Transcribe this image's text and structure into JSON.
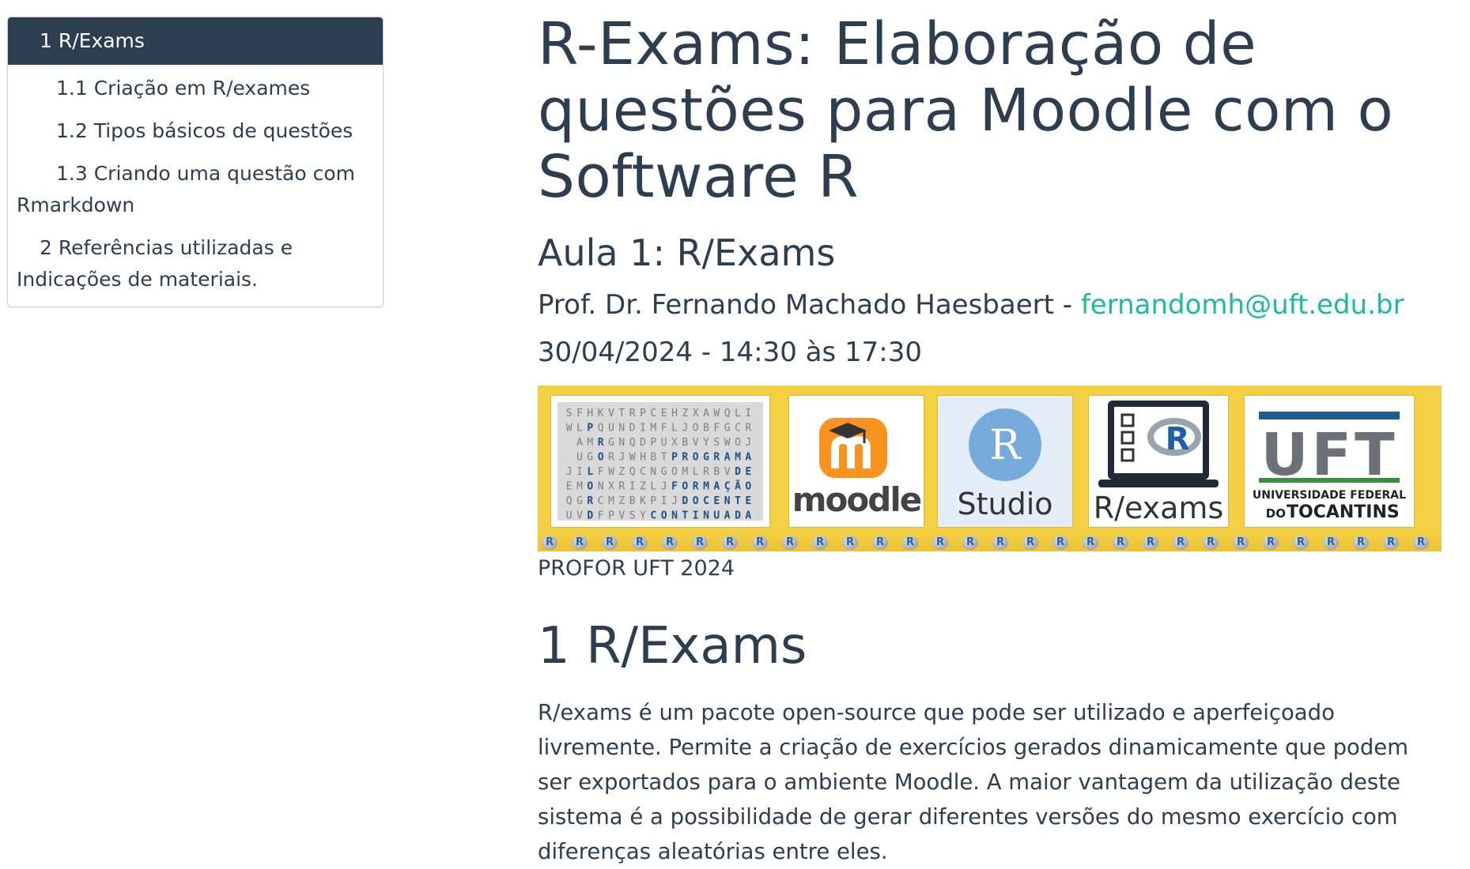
{
  "toc": {
    "items": [
      {
        "label": "1 R/Exams",
        "level": 1,
        "active": true
      },
      {
        "label": "1.1 Criação em R/exames",
        "level": 2
      },
      {
        "label": "1.2 Tipos básicos de questões",
        "level": 2
      },
      {
        "label": "1.3 Criando uma questão com Rmarkdown",
        "level": 2
      },
      {
        "label": "2 Referências utilizadas e Indicações de materiais.",
        "level": 1
      }
    ]
  },
  "header": {
    "title": "R-Exams: Elaboração de questões para Moodle com o Software R",
    "subtitle": "Aula 1: R/Exams",
    "author_prefix": "Prof. Dr. Fernando Machado Haesbaert - ",
    "author_email": "fernandomh@uft.edu.br",
    "date": "30/04/2024 - 14:30 às 17:30"
  },
  "banner": {
    "caption": "PROFOR UFT 2024",
    "colors": {
      "background": "#f3cf43",
      "moodle_orange": "#f7931e",
      "rstudio_blue": "#75aadb",
      "uft_blue": "#1b5e8c",
      "uft_green": "#3a8f3e"
    },
    "wordsearch": {
      "rows": [
        "SFHKVTRPCEHZXAWQLI",
        "WLPQUNDIMFLJOBFGCR",
        "AMRGNQDPUXBVYSWOJ",
        "UGORJWHBTPROGRAMA",
        "JILFWZQCNGOMLRBVDE",
        "EMONXRIZLJFORMAÇÃO",
        "QGRCMZBKPIJDOCENTE",
        "UVDFPVSYCONTINUADA"
      ],
      "highlight": [
        "PROGRAMA",
        "DE",
        "FORMAÇÃO",
        "DOCENTE",
        "CONTINUADA"
      ]
    },
    "moodle_label": "moodle",
    "rstudio_letter": "R",
    "rstudio_label": "Studio",
    "rexams_label": "R/exams",
    "rexams_letter": "R",
    "uft_letters": "UFT",
    "uft_line1": "UNIVERSIDADE FEDERAL",
    "uft_line2_prefix": "DO",
    "uft_line2": "TOCANTINS",
    "r_ball_letter": "R"
  },
  "section": {
    "heading": "1 R/Exams",
    "paragraph": "R/exams é um pacote open-source que pode ser utilizado e aperfeiçoado livremente. Permite a criação de exercícios gerados dinamicamente que podem ser exportados para o ambiente Moodle. A maior vantagem da utilização deste sistema é a possibilidade de gerar diferentes versões do mesmo exercício com diferenças aleatórias entre eles."
  }
}
